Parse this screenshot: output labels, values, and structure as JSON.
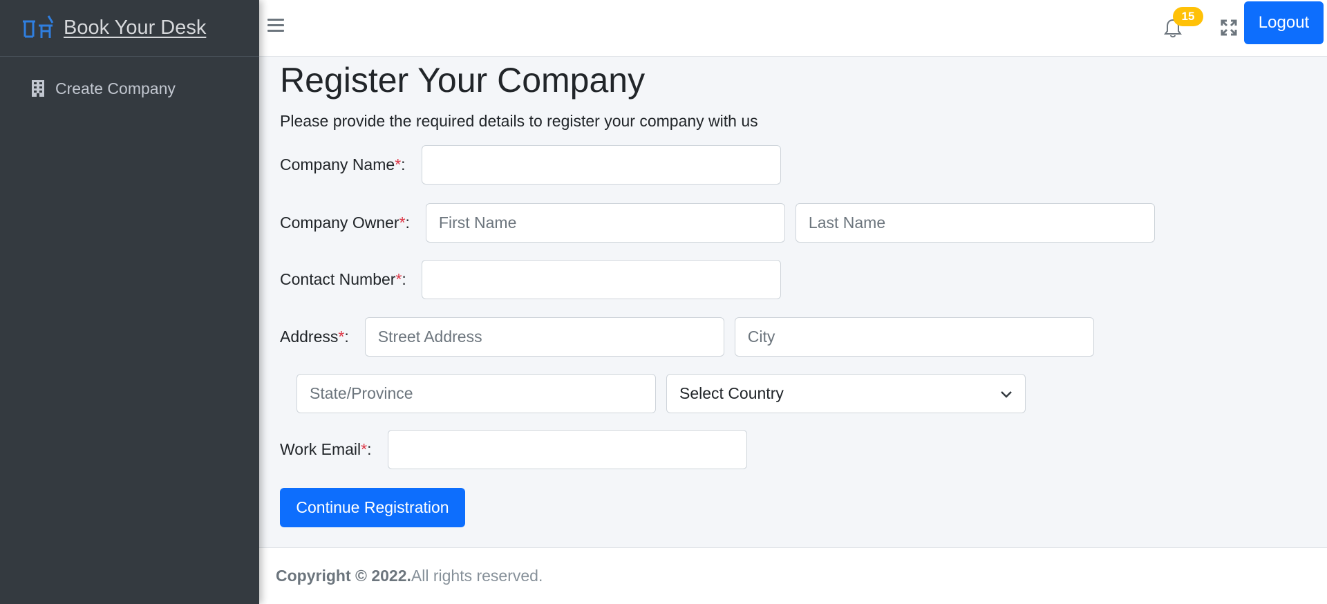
{
  "brand": {
    "name": "Book Your Desk"
  },
  "sidebar": {
    "items": [
      {
        "label": "Create Company",
        "icon": "building-icon"
      }
    ]
  },
  "topbar": {
    "notification_count": "15",
    "logout_label": "Logout"
  },
  "page": {
    "title": "Register Your Company",
    "subtitle": "Please provide the required details to register your company with us"
  },
  "form": {
    "company_name": {
      "label": "Company Name",
      "required": "*",
      "suffix": ":",
      "value": ""
    },
    "company_owner": {
      "label": "Company Owner",
      "required": "*",
      "suffix": ":",
      "first_name_placeholder": "First Name",
      "last_name_placeholder": "Last Name"
    },
    "contact_number": {
      "label": "Contact Number",
      "required": "*",
      "suffix": ":",
      "value": ""
    },
    "address": {
      "label": "Address",
      "required": "*",
      "suffix": ":",
      "street_placeholder": "Street Address",
      "city_placeholder": "City",
      "state_placeholder": "State/Province",
      "country_selected": "Select Country"
    },
    "work_email": {
      "label": "Work Email",
      "required": "*",
      "suffix": ":",
      "value": ""
    },
    "submit_label": "Continue Registration"
  },
  "footer": {
    "copyright_bold": "Copyright © 2022.",
    "rights": "All rights reserved."
  },
  "colors": {
    "primary": "#0d6efd",
    "sidebar": "#343a40",
    "badge": "#ffc107",
    "required": "#dc3545"
  }
}
